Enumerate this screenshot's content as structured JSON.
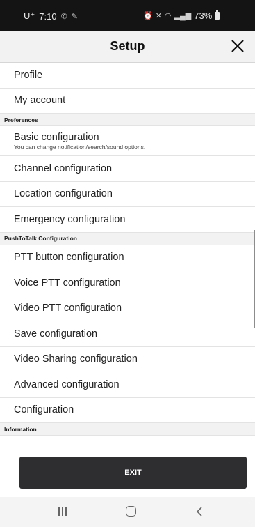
{
  "status_bar": {
    "time": "7:10",
    "carrier": "U⁺",
    "battery": "73%"
  },
  "header": {
    "title": "Setup"
  },
  "list": {
    "profile": "Profile",
    "my_account": "My account",
    "preferences_header": "Preferences",
    "basic_configuration": "Basic configuration",
    "basic_configuration_sub": "You can change notification/search/sound options.",
    "channel_configuration": "Channel configuration",
    "location_configuration": "Location configuration",
    "emergency_configuration": "Emergency configuration",
    "ptt_header": "PushToTalk Configuration",
    "ptt_button_configuration": "PTT button configuration",
    "voice_ptt_configuration": "Voice PTT configuration",
    "video_ptt_configuration": "Video PTT configuration",
    "save_configuration": "Save configuration",
    "video_sharing_configuration": "Video Sharing configuration",
    "advanced_configuration": "Advanced configuration",
    "configuration": "Configuration",
    "information_header": "Information"
  },
  "exit_label": "EXIT",
  "icons": {
    "close": "close-icon",
    "nav_recent": "recent-apps-icon",
    "nav_home": "home-icon",
    "nav_back": "back-icon"
  },
  "colors": {
    "status_bar_bg": "#141414",
    "header_bg": "#f2f2f2",
    "exit_button_bg": "#2e2e30"
  }
}
